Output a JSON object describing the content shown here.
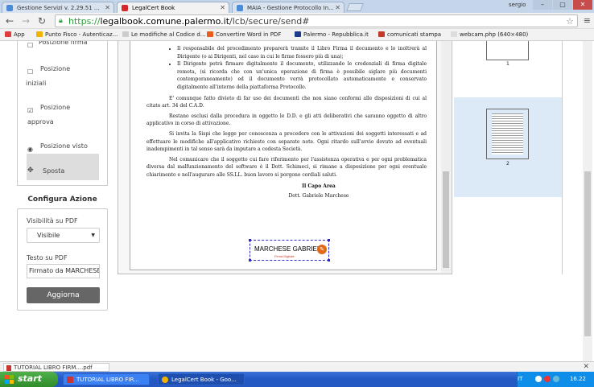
{
  "browser": {
    "tabs": [
      {
        "label": "Gestione Servizi v. 2.29.51 ...",
        "color": "#4a8bd8"
      },
      {
        "label": "LegalCert Book",
        "color": "#d62828"
      },
      {
        "label": "MAIA - Gestione Protocollo In...",
        "color": "#4a8bd8"
      }
    ],
    "user": "sergio",
    "window_buttons": {
      "minimize": "–",
      "maximize": "▢",
      "close": "✕"
    },
    "url_scheme": "https://",
    "url_host": "legalbook.comune.palermo.it",
    "url_path": "/lcb/secure/send#",
    "bookmarks": [
      {
        "label": "App",
        "color": "#e23b3b"
      },
      {
        "label": "Punto Fisco - Autenticaz...",
        "color": "#f0b400"
      },
      {
        "label": "Le modifiche al Codice d...",
        "color": "#cccccc"
      },
      {
        "label": "Convertire Word in PDF",
        "color": "#e85d1f"
      },
      {
        "label": "Palermo - Repubblica.it",
        "color": "#1a3c8a"
      },
      {
        "label": "comunicati stampa",
        "color": "#c23a2a"
      },
      {
        "label": "webcam.php (640×480)",
        "color": "#dddddd"
      }
    ]
  },
  "sidebar": {
    "items": [
      {
        "icon": "☐",
        "label": "Posizione firma"
      },
      {
        "icon": "☐",
        "label": "Posizione",
        "label2": "iniziali"
      },
      {
        "icon": "☑",
        "label": "Posizione",
        "label2": "approva"
      },
      {
        "icon": "◉",
        "label": "Posizione visto"
      }
    ],
    "move_label": "Sposta",
    "move_icon": "✥"
  },
  "config": {
    "title": "Configura Azione",
    "visibility_label": "Visibilità su PDF",
    "visibility_value": "Visibile",
    "text_label": "Testo su PDF",
    "text_value": "Firmato da MARCHESE",
    "add_button": "Aggiorna"
  },
  "document": {
    "bullets": [
      "Il responsabile del procedimento preparerà tramite il Libro Firma il documento e lo inoltrerà al Dirigente (o ai Dirigenti, nel caso in cui le firme fossero più di una);",
      "Il Dirigente potrà firmare digitalmente il documento, utilizzando le credenziali di firma digitale remota, (si ricorda che con un'unica operazione di firma è possibile siglare più documenti contemporaneamente) ed il documento verrà protocollato automaticamente e conservato digitalmente all'interno della piattaforma Protocollo."
    ],
    "paragraphs": [
      "E' comunque fatto divieto di far uso dei documenti che non siano conformi alle disposizioni di cui al citato art. 34 del C.A.D.",
      "Restano esclusi dalla procedura in oggetto le D.D. e gli atti deliberativi che saranno oggetto di altro applicativo in corso di attivazione.",
      "Si invita la Sispi che legge per conoscenza a procedere con le attivazioni dei soggetti interessati e ad effettuare le modifiche all'applicativo richieste con separate note. Ogni ritardo sull'avvio dovuto ad eventuali inadempimenti in tal senso sarà da imputare a codesta Società.",
      "Nel comunicare che il soggetto cui fare riferimento per l'assistenza operativa e per ogni problematica diversa dal malfunzionamento del software è il Dott. Schimeci, si rimane a disposizione per ogni eventuale chiarimento e nell'augurare alle SS.LL. buon lavoro si porgono cordiali saluti."
    ],
    "signoff_title": "Il Capo Area",
    "signoff_name": "Dott. Gabriele Marchese",
    "signature_name": "MARCHESE GABRIELE",
    "signature_sub": "Firma Digitale"
  },
  "thumbnails": [
    {
      "page": "1"
    },
    {
      "page": "2"
    }
  ],
  "download": {
    "item": "TUTORIAL LIBRO FIRM....pdf",
    "close": "✕"
  },
  "taskbar": {
    "start": "start",
    "items": [
      {
        "label": "TUTORIAL LIBRO FIR...",
        "color": "#c33"
      },
      {
        "label": "LegalCert Book - Goo...",
        "color": "#f0b400"
      }
    ],
    "lang": "IT",
    "clock": "16.22"
  }
}
